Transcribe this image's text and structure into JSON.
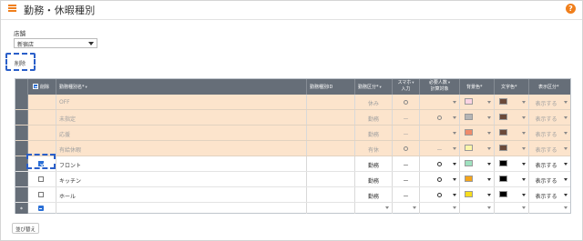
{
  "header": {
    "title": "勤務・休暇種別",
    "help": "?"
  },
  "store": {
    "label": "店舗",
    "value": "新宿店"
  },
  "toolbar": {
    "delete_label": "削除",
    "sort_label": "並び替え"
  },
  "table": {
    "columns": {
      "delete": "削除",
      "name": "勤務種別名",
      "id": "勤務種別ID",
      "category": "勤務区分",
      "smartphone_l1": "スマホ",
      "smartphone_l2": "入力",
      "required_l1": "必要人数",
      "required_l2": "計算対象",
      "bg_color": "背景色",
      "text_color": "文字色",
      "display": "表示区分"
    },
    "required_mark": "*",
    "rows": [
      {
        "name": "OFF",
        "category": "休み",
        "smartphone": "circle",
        "required": "",
        "bg": "#fbd3e2",
        "fg": "#6b4a3a",
        "display": "表示する",
        "checked": false,
        "type": "preset"
      },
      {
        "name": "未指定",
        "category": "勤務",
        "smartphone": "ー",
        "required": "circle",
        "bg": "#b5b5b5",
        "fg": "#6b4a3a",
        "display": "表示する",
        "checked": false,
        "type": "preset"
      },
      {
        "name": "応援",
        "category": "勤務",
        "smartphone": "ー",
        "required": "",
        "bg": "#f08a6a",
        "fg": "#6b4a3a",
        "display": "表示する",
        "checked": false,
        "type": "preset"
      },
      {
        "name": "有給休暇",
        "category": "有休",
        "smartphone": "circle",
        "required": "ー",
        "bg": "#fdf6a8",
        "fg": "#6b4a3a",
        "display": "表示する",
        "checked": false,
        "type": "preset"
      },
      {
        "name": "フロント",
        "category": "勤務",
        "smartphone": "ー",
        "required": "circle",
        "bg": "#9fe2c0",
        "fg": "#000000",
        "display": "表示する",
        "checked": true,
        "type": "custom"
      },
      {
        "name": "キッチン",
        "category": "勤務",
        "smartphone": "ー",
        "required": "circle",
        "bg": "#f4a51c",
        "fg": "#000000",
        "display": "表示する",
        "checked": false,
        "type": "custom"
      },
      {
        "name": "ホール",
        "category": "勤務",
        "smartphone": "ー",
        "required": "circle",
        "bg": "#f7dd1d",
        "fg": "#000000",
        "display": "表示する",
        "checked": false,
        "type": "custom"
      }
    ],
    "new_row_marker": "*"
  },
  "colors": {
    "accent": "#f07f1c",
    "header_bg": "#666e78",
    "preset_row_bg": "#fce4cc",
    "highlight": "#2a5fc9"
  }
}
